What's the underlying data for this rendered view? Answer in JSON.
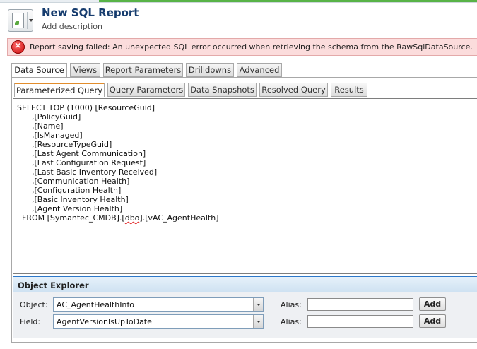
{
  "header": {
    "title": "New SQL Report",
    "add_description": "Add description",
    "icon": "report-doc-icon"
  },
  "error": {
    "icon": "error-x-icon",
    "message": "Report saving failed: An unexpected SQL error occurred when retrieving the schema from the RawSqlDataSource."
  },
  "tabs_main": [
    {
      "label": "Data Source",
      "active": true
    },
    {
      "label": "Views"
    },
    {
      "label": "Report Parameters"
    },
    {
      "label": "Drilldowns"
    },
    {
      "label": "Advanced"
    }
  ],
  "tabs_sub": [
    {
      "label": "Parameterized Query",
      "active": true
    },
    {
      "label": "Query Parameters"
    },
    {
      "label": "Data Snapshots"
    },
    {
      "label": "Resolved Query"
    },
    {
      "label": "Results"
    }
  ],
  "sql": {
    "lines": [
      "SELECT TOP (1000) [ResourceGuid]",
      "      ,[PolicyGuid]",
      "      ,[Name]",
      "      ,[IsManaged]",
      "      ,[ResourceTypeGuid]",
      "      ,[Last Agent Communication]",
      "      ,[Last Configuration Request]",
      "      ,[Last Basic Inventory Received]",
      "      ,[Communication Health]",
      "      ,[Configuration Health]",
      "      ,[Basic Inventory Health]",
      "      ,[Agent Version Health]"
    ],
    "from_prefix": "  FROM [Symantec_CMDB].[",
    "from_schema": "dbo",
    "from_suffix": "].[vAC_AgentHealth]"
  },
  "object_explorer": {
    "title": "Object Explorer",
    "object_label": "Object:",
    "object_value": "AC_AgentHealthInfo",
    "field_label": "Field:",
    "field_value": "AgentVersionIsUpToDate",
    "alias_label": "Alias:",
    "alias_value": "",
    "add_label": "Add"
  },
  "colors": {
    "title": "#163c6e",
    "error_bg": "#fbdcdc",
    "active_tab_accent": "#e28d2c",
    "explorer_accent": "#2d78c9"
  }
}
